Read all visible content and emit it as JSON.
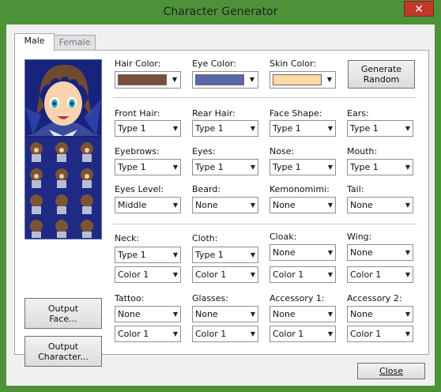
{
  "window": {
    "title": "Character Generator",
    "close_glyph": "✕"
  },
  "tabs": [
    {
      "label": "Male"
    },
    {
      "label": "Female"
    }
  ],
  "colors": {
    "hair": "#7a4f3a",
    "eye": "#5868a8",
    "skin": "#ffd9a6"
  },
  "color_labels": {
    "hair": "Hair Color:",
    "eye": "Eye Color:",
    "skin": "Skin Color:"
  },
  "buttons": {
    "generate_random": [
      "Generate",
      "Random"
    ],
    "output_face": [
      "Output",
      "Face..."
    ],
    "output_character": [
      "Output",
      "Character..."
    ],
    "close": "Close"
  },
  "parts": {
    "front_hair": {
      "label": "Front Hair:",
      "value": "Type 1"
    },
    "rear_hair": {
      "label": "Rear Hair:",
      "value": "Type 1"
    },
    "face_shape": {
      "label": "Face Shape:",
      "value": "Type 1"
    },
    "ears": {
      "label": "Ears:",
      "value": "Type 1"
    },
    "eyebrows": {
      "label": "Eyebrows:",
      "value": "Type 1"
    },
    "eyes": {
      "label": "Eyes:",
      "value": "Type 1"
    },
    "nose": {
      "label": "Nose:",
      "value": "Type 1"
    },
    "mouth": {
      "label": "Mouth:",
      "value": "Type 1"
    },
    "eyes_level": {
      "label": "Eyes Level:",
      "value": "Middle"
    },
    "beard": {
      "label": "Beard:",
      "value": "None"
    },
    "kemonomimi": {
      "label": "Kemonomimi:",
      "value": "None"
    },
    "tail": {
      "label": "Tail:",
      "value": "None"
    }
  },
  "accessories": {
    "neck": {
      "label": "Neck:",
      "value": "Type 1",
      "color": "Color 1"
    },
    "cloth": {
      "label": "Cloth:",
      "value": "Type 1",
      "color": "Color 1"
    },
    "cloak": {
      "label": "Cloak:",
      "value": "None",
      "color": "Color 1"
    },
    "wing": {
      "label": "Wing:",
      "value": "None",
      "color": "Color 1"
    },
    "tattoo": {
      "label": "Tattoo:",
      "value": "None",
      "color": "Color 1"
    },
    "glasses": {
      "label": "Glasses:",
      "value": "None",
      "color": "Color 1"
    },
    "accessory1": {
      "label": "Accessory 1:",
      "value": "None",
      "color": "Color 1"
    },
    "accessory2": {
      "label": "Accessory 2:",
      "value": "None",
      "color": "Color 1"
    }
  },
  "dropdown_arrow": "▼"
}
